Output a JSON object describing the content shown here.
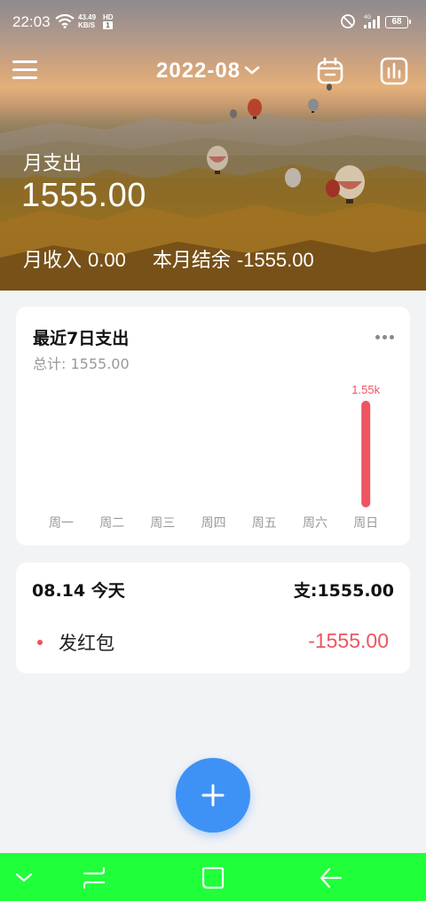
{
  "status_bar": {
    "time": "22:03",
    "net_speed": "43.49",
    "net_unit": "KB/S",
    "hd_label": "HD",
    "hd_sub": "1",
    "signal_label": "4G",
    "battery": "68",
    "icons": [
      "wifi-icon",
      "do-not-disturb-icon",
      "signal-icon",
      "battery-icon"
    ]
  },
  "toolbar": {
    "month": "2022-08",
    "icons": [
      "menu-icon",
      "chevron-down-icon",
      "calendar-icon",
      "bar-chart-icon"
    ]
  },
  "summary": {
    "expense_label": "月支出",
    "expense_value": "1555.00",
    "income_label": "月收入",
    "income_value": "0.00",
    "balance_label": "本月结余",
    "balance_value": "-1555.00"
  },
  "weekly_card": {
    "title": "最近7日支出",
    "total": "总计: 1555.00",
    "more_icon": "more-horizontal-icon",
    "bar_color": "#ee5560",
    "label_color": "#ee5560",
    "axis_color": "#999999"
  },
  "chart_data": {
    "type": "bar",
    "categories": [
      "周一",
      "周二",
      "周三",
      "周四",
      "周五",
      "周六",
      "周日"
    ],
    "values": [
      0,
      0,
      0,
      0,
      0,
      0,
      1555
    ],
    "data_labels": [
      "",
      "",
      "",
      "",
      "",
      "",
      "1.55k"
    ],
    "ylim": [
      0,
      1555
    ],
    "grid": false,
    "title": "",
    "xlabel": "",
    "ylabel": ""
  },
  "day_group": {
    "date": "08.14 今天",
    "sum": "支:1555.00",
    "items": [
      {
        "name": "发红包",
        "amount": "-1555.00"
      }
    ]
  },
  "fab": {
    "icon": "plus-icon",
    "color": "#3f92f5"
  },
  "nav_bar": {
    "color": "#1fff3a",
    "icons": [
      "nav-hide-icon",
      "nav-menu-icon",
      "nav-home-icon",
      "nav-back-icon"
    ]
  }
}
